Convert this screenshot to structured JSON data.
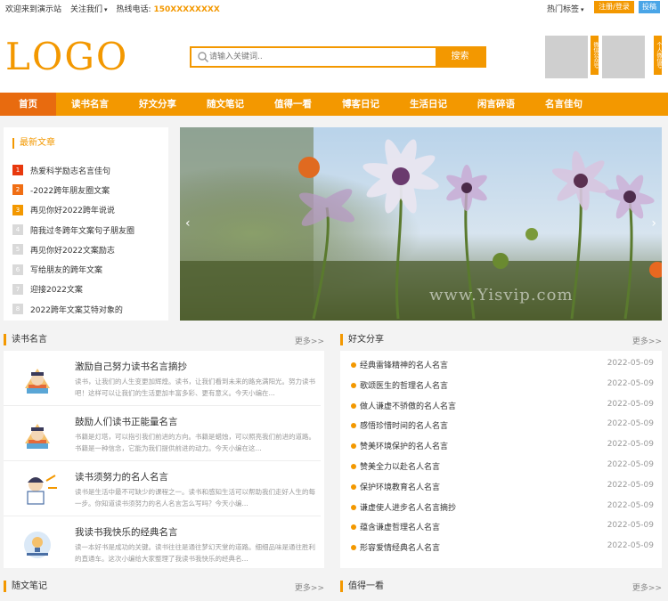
{
  "topbar": {
    "welcome": "欢迎来到演示站",
    "follow": "关注我们",
    "follow_chevron": "▾",
    "hotline_label": "热线电话:",
    "hotline_number": "150XXXXXXXX",
    "hot_tags": "热门标签",
    "hot_tags_chevron": "▾",
    "login_label": "注册/登录",
    "submit_label": "投稿"
  },
  "header": {
    "logo": "LOGO",
    "search_placeholder": "请输入关键词..",
    "search_button": "搜索",
    "qr_tag_1": "微信公众号",
    "qr_tag_2": "个人微信号"
  },
  "nav": {
    "items": [
      "首页",
      "读书名言",
      "好文分享",
      "随文笔记",
      "值得一看",
      "博客日记",
      "生活日记",
      "闲言碎语",
      "名言佳句"
    ]
  },
  "latest": {
    "title": "最新文章",
    "items": [
      {
        "num": "1",
        "text": "热爱科学励志名言佳句"
      },
      {
        "num": "2",
        "text": "-2022跨年朋友圈文案"
      },
      {
        "num": "3",
        "text": "再见你好2022跨年说说"
      },
      {
        "num": "4",
        "text": "陪我过冬跨年文案句子朋友圈"
      },
      {
        "num": "5",
        "text": "再见你好2022文案励志"
      },
      {
        "num": "6",
        "text": "写给朋友的跨年文案"
      },
      {
        "num": "7",
        "text": "迎接2022文案"
      },
      {
        "num": "8",
        "text": "2022跨年文案艾特对象的"
      }
    ]
  },
  "banner": {
    "watermark": "www.Yisvip.com",
    "prev_icon": "‹",
    "next_icon": "›"
  },
  "sections": {
    "reading": {
      "title": "读书名言",
      "more": "更多>>",
      "items": [
        {
          "title": "激励自己努力读书名言摘抄",
          "desc": "读书，让我们的人生变更加辉煌。读书，让我们看到未来的路充满阳光。努力读书吧！这样可以让我们的生活更加丰富多彩、更有意义。今天小编在..."
        },
        {
          "title": "鼓励人们读书正能量名言",
          "desc": "书籍是灯塔，可以指引我们前进的方向。书籍是蜡烛，可以照亮我们前进的道路。书籍是一种信念，它能为我们提供前进的动力。今天小编在这..."
        },
        {
          "title": "读书须努力的名人名言",
          "desc": "读书是生活中最不可缺少的课程之一。读书和感知生活可以帮助我们走好人生的每一步。你知道读书须努力的名人名言怎么写吗？今天小编..."
        },
        {
          "title": "我读书我快乐的经典名言",
          "desc": "读一本好书是成功的关键。读书往往是通往梦幻天堂的道路。细细品味是通往胜利的直通车。这次小编给大家整理了我读书我快乐的经典名..."
        }
      ]
    },
    "share": {
      "title": "好文分享",
      "more": "更多>>",
      "items": [
        {
          "text": "经典雷锋精神的名人名言",
          "date": "2022-05-09"
        },
        {
          "text": "歌颂医生的哲理名人名言",
          "date": "2022-05-09"
        },
        {
          "text": "做人谦虚不骄傲的名人名言",
          "date": "2022-05-09"
        },
        {
          "text": "感悟珍惜时间的名人名言",
          "date": "2022-05-09"
        },
        {
          "text": "赞美环境保护的名人名言",
          "date": "2022-05-09"
        },
        {
          "text": "赞美全力以赴名人名言",
          "date": "2022-05-09"
        },
        {
          "text": "保护环境教育名人名言",
          "date": "2022-05-09"
        },
        {
          "text": "谦虚使人进步名人名言摘抄",
          "date": "2022-05-09"
        },
        {
          "text": "蕴含谦虚哲理名人名言",
          "date": "2022-05-09"
        },
        {
          "text": "形容爱情经典名人名言",
          "date": "2022-05-09"
        }
      ]
    },
    "notes": {
      "title": "随文笔记",
      "more": "更多>>"
    },
    "worth": {
      "title": "值得一看",
      "more": "更多>>"
    }
  },
  "colors": {
    "accent": "#f39800",
    "nav_active": "#e86b0f",
    "login": "#f39800",
    "submit": "#4aa5e7"
  }
}
